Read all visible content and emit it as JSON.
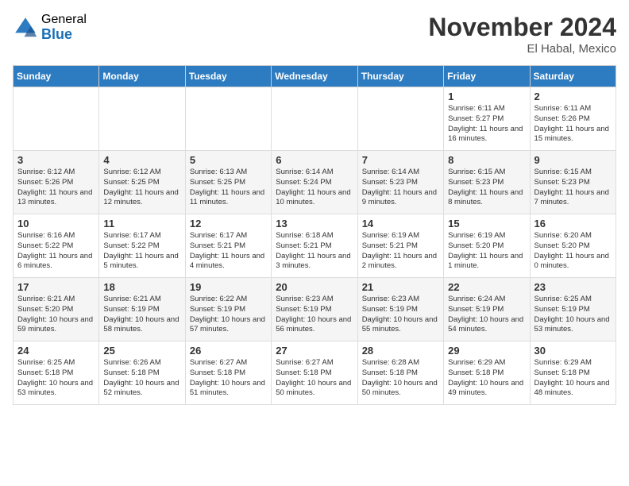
{
  "logo": {
    "general": "General",
    "blue": "Blue"
  },
  "header": {
    "month": "November 2024",
    "location": "El Habal, Mexico"
  },
  "weekdays": [
    "Sunday",
    "Monday",
    "Tuesday",
    "Wednesday",
    "Thursday",
    "Friday",
    "Saturday"
  ],
  "weeks": [
    [
      {
        "day": "",
        "info": ""
      },
      {
        "day": "",
        "info": ""
      },
      {
        "day": "",
        "info": ""
      },
      {
        "day": "",
        "info": ""
      },
      {
        "day": "",
        "info": ""
      },
      {
        "day": "1",
        "info": "Sunrise: 6:11 AM\nSunset: 5:27 PM\nDaylight: 11 hours and 16 minutes."
      },
      {
        "day": "2",
        "info": "Sunrise: 6:11 AM\nSunset: 5:26 PM\nDaylight: 11 hours and 15 minutes."
      }
    ],
    [
      {
        "day": "3",
        "info": "Sunrise: 6:12 AM\nSunset: 5:26 PM\nDaylight: 11 hours and 13 minutes."
      },
      {
        "day": "4",
        "info": "Sunrise: 6:12 AM\nSunset: 5:25 PM\nDaylight: 11 hours and 12 minutes."
      },
      {
        "day": "5",
        "info": "Sunrise: 6:13 AM\nSunset: 5:25 PM\nDaylight: 11 hours and 11 minutes."
      },
      {
        "day": "6",
        "info": "Sunrise: 6:14 AM\nSunset: 5:24 PM\nDaylight: 11 hours and 10 minutes."
      },
      {
        "day": "7",
        "info": "Sunrise: 6:14 AM\nSunset: 5:23 PM\nDaylight: 11 hours and 9 minutes."
      },
      {
        "day": "8",
        "info": "Sunrise: 6:15 AM\nSunset: 5:23 PM\nDaylight: 11 hours and 8 minutes."
      },
      {
        "day": "9",
        "info": "Sunrise: 6:15 AM\nSunset: 5:23 PM\nDaylight: 11 hours and 7 minutes."
      }
    ],
    [
      {
        "day": "10",
        "info": "Sunrise: 6:16 AM\nSunset: 5:22 PM\nDaylight: 11 hours and 6 minutes."
      },
      {
        "day": "11",
        "info": "Sunrise: 6:17 AM\nSunset: 5:22 PM\nDaylight: 11 hours and 5 minutes."
      },
      {
        "day": "12",
        "info": "Sunrise: 6:17 AM\nSunset: 5:21 PM\nDaylight: 11 hours and 4 minutes."
      },
      {
        "day": "13",
        "info": "Sunrise: 6:18 AM\nSunset: 5:21 PM\nDaylight: 11 hours and 3 minutes."
      },
      {
        "day": "14",
        "info": "Sunrise: 6:19 AM\nSunset: 5:21 PM\nDaylight: 11 hours and 2 minutes."
      },
      {
        "day": "15",
        "info": "Sunrise: 6:19 AM\nSunset: 5:20 PM\nDaylight: 11 hours and 1 minute."
      },
      {
        "day": "16",
        "info": "Sunrise: 6:20 AM\nSunset: 5:20 PM\nDaylight: 11 hours and 0 minutes."
      }
    ],
    [
      {
        "day": "17",
        "info": "Sunrise: 6:21 AM\nSunset: 5:20 PM\nDaylight: 10 hours and 59 minutes."
      },
      {
        "day": "18",
        "info": "Sunrise: 6:21 AM\nSunset: 5:19 PM\nDaylight: 10 hours and 58 minutes."
      },
      {
        "day": "19",
        "info": "Sunrise: 6:22 AM\nSunset: 5:19 PM\nDaylight: 10 hours and 57 minutes."
      },
      {
        "day": "20",
        "info": "Sunrise: 6:23 AM\nSunset: 5:19 PM\nDaylight: 10 hours and 56 minutes."
      },
      {
        "day": "21",
        "info": "Sunrise: 6:23 AM\nSunset: 5:19 PM\nDaylight: 10 hours and 55 minutes."
      },
      {
        "day": "22",
        "info": "Sunrise: 6:24 AM\nSunset: 5:19 PM\nDaylight: 10 hours and 54 minutes."
      },
      {
        "day": "23",
        "info": "Sunrise: 6:25 AM\nSunset: 5:19 PM\nDaylight: 10 hours and 53 minutes."
      }
    ],
    [
      {
        "day": "24",
        "info": "Sunrise: 6:25 AM\nSunset: 5:18 PM\nDaylight: 10 hours and 53 minutes."
      },
      {
        "day": "25",
        "info": "Sunrise: 6:26 AM\nSunset: 5:18 PM\nDaylight: 10 hours and 52 minutes."
      },
      {
        "day": "26",
        "info": "Sunrise: 6:27 AM\nSunset: 5:18 PM\nDaylight: 10 hours and 51 minutes."
      },
      {
        "day": "27",
        "info": "Sunrise: 6:27 AM\nSunset: 5:18 PM\nDaylight: 10 hours and 50 minutes."
      },
      {
        "day": "28",
        "info": "Sunrise: 6:28 AM\nSunset: 5:18 PM\nDaylight: 10 hours and 50 minutes."
      },
      {
        "day": "29",
        "info": "Sunrise: 6:29 AM\nSunset: 5:18 PM\nDaylight: 10 hours and 49 minutes."
      },
      {
        "day": "30",
        "info": "Sunrise: 6:29 AM\nSunset: 5:18 PM\nDaylight: 10 hours and 48 minutes."
      }
    ]
  ]
}
